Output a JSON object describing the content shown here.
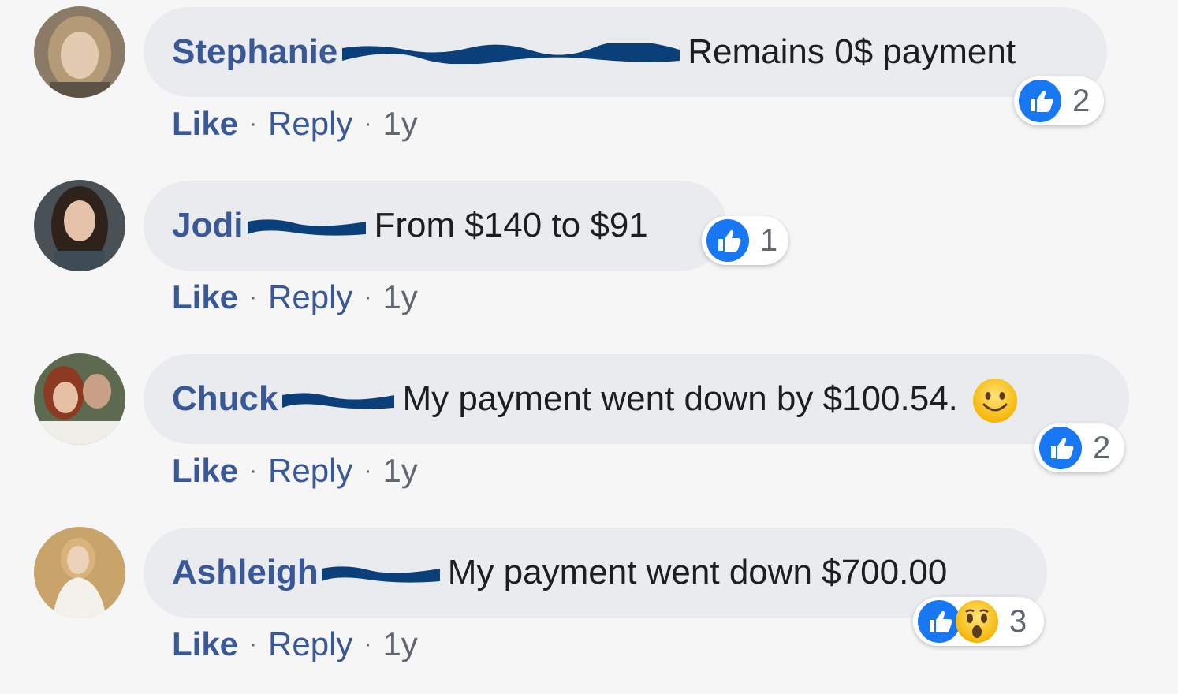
{
  "colors": {
    "name_link": "#385898",
    "bubble_bg": "#e9ebee",
    "like_blue": "#1877f2",
    "redaction": "#0b3f7a"
  },
  "comments": [
    {
      "first_name": "Stephanie",
      "text": "Remains 0$ payment",
      "actions": {
        "like": "Like",
        "reply": "Reply",
        "time": "1y"
      },
      "reactions": {
        "icons": [
          "like-icon"
        ],
        "count": "2"
      }
    },
    {
      "first_name": "Jodi",
      "text": "From $140 to $91",
      "actions": {
        "like": "Like",
        "reply": "Reply",
        "time": "1y"
      },
      "reactions": {
        "icons": [
          "like-icon"
        ],
        "count": "1"
      }
    },
    {
      "first_name": "Chuck",
      "text": "My payment went down by $100.54.",
      "emoji": "smiley-emoji",
      "actions": {
        "like": "Like",
        "reply": "Reply",
        "time": "1y"
      },
      "reactions": {
        "icons": [
          "like-icon"
        ],
        "count": "2"
      }
    },
    {
      "first_name": "Ashleigh",
      "text": "My payment went down $700.00",
      "actions": {
        "like": "Like",
        "reply": "Reply",
        "time": "1y"
      },
      "reactions": {
        "icons": [
          "like-icon",
          "wow-icon"
        ],
        "count": "3"
      }
    }
  ],
  "separator": "·"
}
